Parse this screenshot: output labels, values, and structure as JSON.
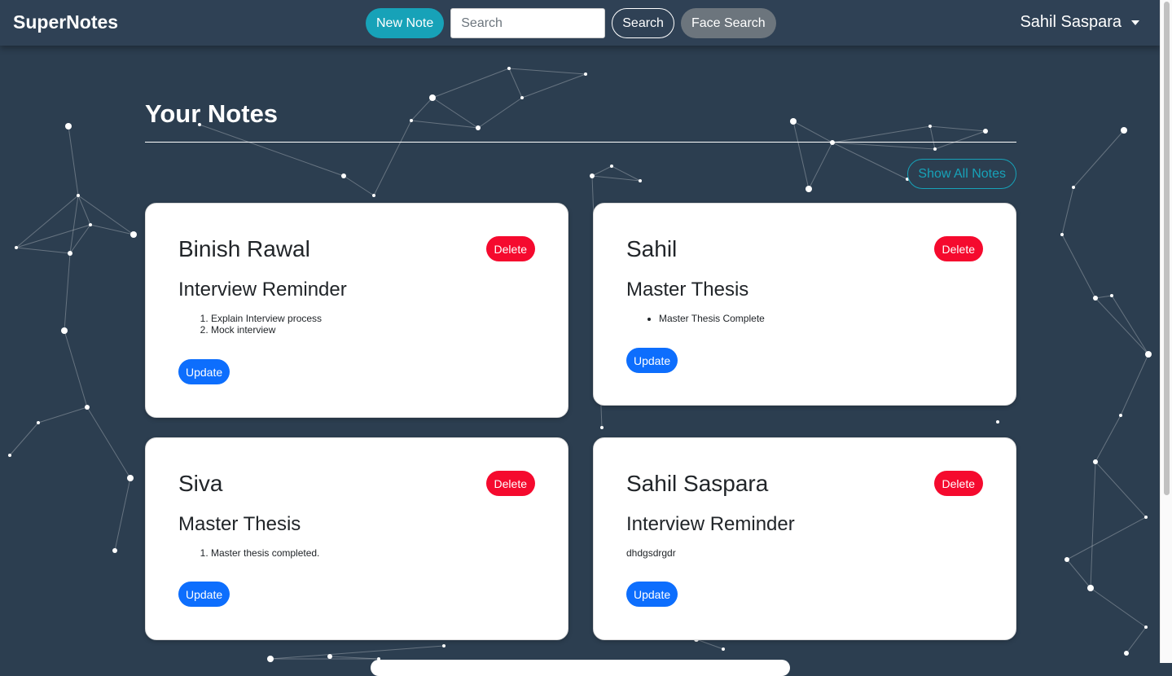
{
  "navbar": {
    "brand": "SuperNotes",
    "new_note_label": "New Note",
    "search_placeholder": "Search",
    "search_value": "",
    "search_button_label": "Search",
    "face_search_label": "Face Search",
    "user_name": "Sahil Saspara"
  },
  "page": {
    "title": "Your Notes",
    "show_all_label": "Show All Notes"
  },
  "notes": [
    {
      "author": "Binish Rawal",
      "title": "Interview Reminder",
      "list_type": "ordered",
      "items": [
        "Explain Interview process",
        "Mock interview"
      ],
      "delete_label": "Delete",
      "update_label": "Update"
    },
    {
      "author": "Sahil",
      "title": "Master Thesis",
      "list_type": "unordered",
      "items": [
        "Master Thesis Complete"
      ],
      "delete_label": "Delete",
      "update_label": "Update"
    },
    {
      "author": "Siva",
      "title": "Master Thesis",
      "list_type": "ordered",
      "items": [
        "Master thesis completed."
      ],
      "delete_label": "Delete",
      "update_label": "Update"
    },
    {
      "author": "Sahil Saspara",
      "title": "Interview Reminder",
      "list_type": "text",
      "text": "dhdgsdrgdr",
      "delete_label": "Delete",
      "update_label": "Update"
    }
  ],
  "colors": {
    "background": "#2c3e50",
    "navbar": "#2f4155",
    "accent_teal": "#17a2b8",
    "delete_red": "#f50a2e",
    "update_blue": "#0d6efd",
    "secondary_gray": "#6c757d"
  },
  "icons": {
    "user_menu_caret": "caret-down-icon"
  }
}
